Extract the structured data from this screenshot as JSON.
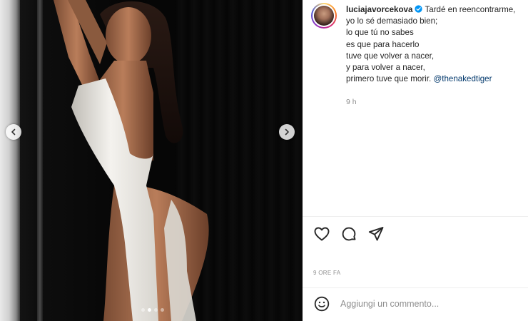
{
  "post": {
    "username": "luciajavorcekova",
    "verified": true,
    "caption_lines": [
      "Tardé en reencontrarme,",
      "yo lo sé demasiado bien;",
      "lo que tú no sabes",
      "es que para hacerlo",
      "tuve que volver a nacer,",
      "y para volver a nacer,",
      "primero tuve que morir."
    ],
    "mention": "@thenakedtiger",
    "caption_age": "9 h",
    "post_time": "9 ORE FA"
  },
  "carousel": {
    "slide_count": 4,
    "active_index": 1
  },
  "comment": {
    "placeholder": "Aggiungi un commento..."
  },
  "icons": {
    "prev": "chevron-left-icon",
    "next": "chevron-right-icon",
    "like": "heart-icon",
    "comment": "comment-bubble-icon",
    "share": "paper-plane-icon",
    "emoji": "smiley-icon",
    "verified": "verified-badge-icon"
  },
  "colors": {
    "mention": "#00376b",
    "verified": "#0095f6",
    "secondary_text": "#8e8e8e"
  }
}
